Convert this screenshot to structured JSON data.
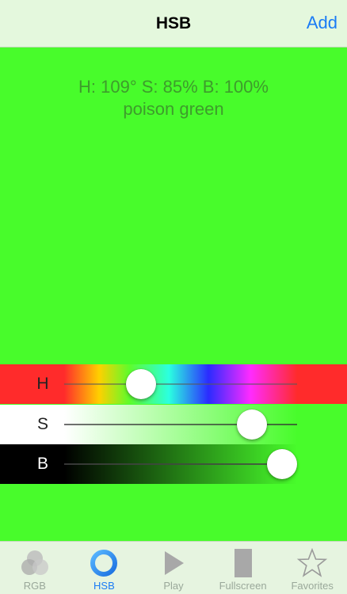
{
  "navbar": {
    "title": "HSB",
    "add_label": "Add"
  },
  "color": {
    "hex": "#48fc2b",
    "readout": "H: 109° S: 85% B: 100%",
    "name": "poison green"
  },
  "sliders": [
    {
      "label": "H",
      "value": 109,
      "max": 360
    },
    {
      "label": "S",
      "value": 85,
      "max": 100
    },
    {
      "label": "B",
      "value": 100,
      "max": 100
    }
  ],
  "tabs": [
    {
      "label": "RGB",
      "icon": "rgb-circles-icon",
      "active": false
    },
    {
      "label": "HSB",
      "icon": "hsb-ring-icon",
      "active": true
    },
    {
      "label": "Play",
      "icon": "play-icon",
      "active": false
    },
    {
      "label": "Fullscreen",
      "icon": "fullscreen-icon",
      "active": false
    },
    {
      "label": "Favorites",
      "icon": "star-icon",
      "active": false
    }
  ],
  "colors": {
    "accent": "#1a7cf5",
    "inactive": "#9aa89a",
    "tabbar_bg": "#e6f4e0"
  }
}
